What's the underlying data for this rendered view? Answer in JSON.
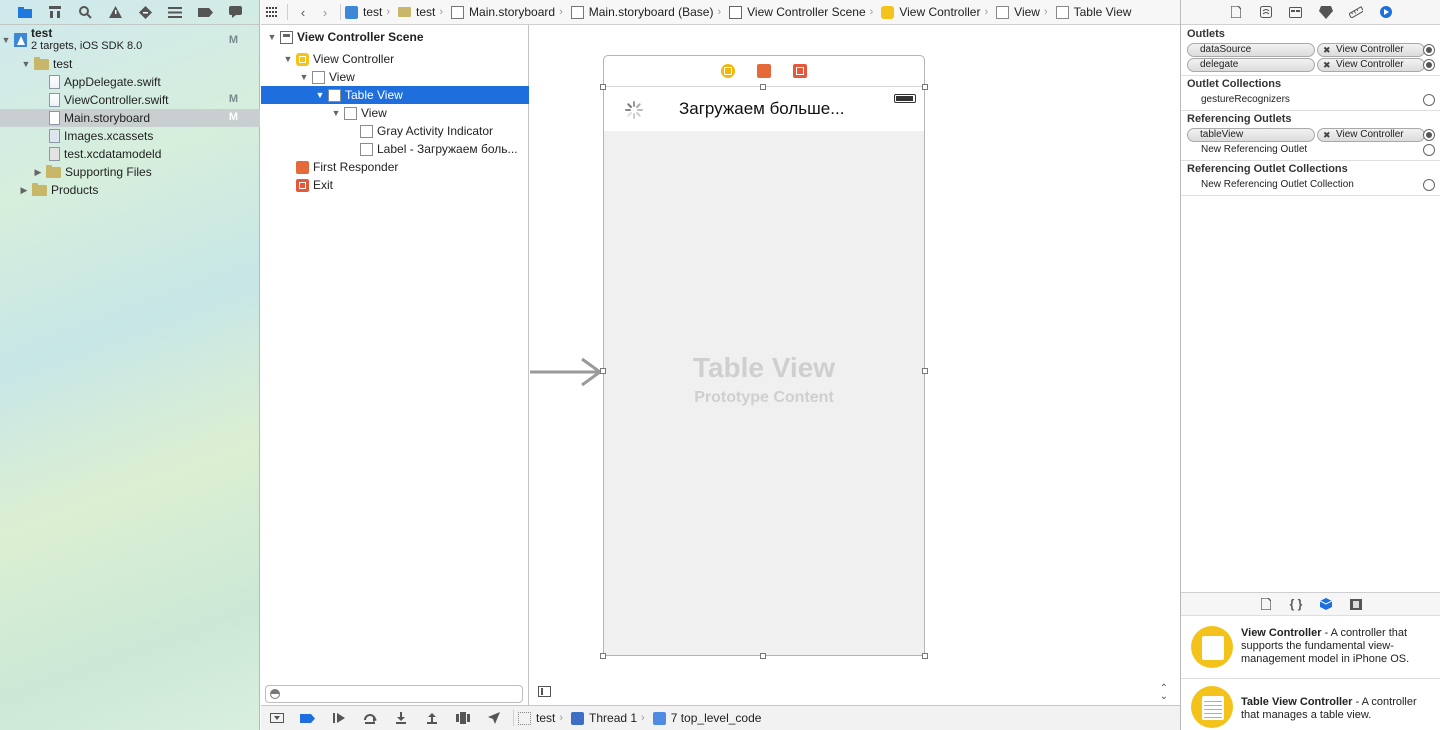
{
  "navigator": {
    "tabs": [
      "project-navigator",
      "symbol-navigator",
      "find-navigator",
      "issue-navigator",
      "test-navigator",
      "debug-navigator",
      "breakpoint-navigator",
      "report-navigator"
    ],
    "project": {
      "name": "test",
      "subtitle": "2 targets, iOS SDK 8.0",
      "badge": "M"
    },
    "items": [
      {
        "label": "test",
        "kind": "folder"
      },
      {
        "label": "AppDelegate.swift",
        "kind": "swift",
        "badge": ""
      },
      {
        "label": "ViewController.swift",
        "kind": "swift",
        "badge": "M"
      },
      {
        "label": "Main.storyboard",
        "kind": "storyboard",
        "badge": "M"
      },
      {
        "label": "Images.xcassets",
        "kind": "assets",
        "badge": ""
      },
      {
        "label": "test.xcdatamodeld",
        "kind": "datamodel",
        "badge": ""
      },
      {
        "label": "Supporting Files",
        "kind": "folder"
      },
      {
        "label": "Products",
        "kind": "folder"
      }
    ]
  },
  "jumpbar": {
    "crumbs": [
      "test",
      "test",
      "Main.storyboard",
      "Main.storyboard (Base)",
      "View Controller Scene",
      "View Controller",
      "View",
      "Table View"
    ]
  },
  "outline": {
    "items": [
      {
        "label": "View Controller Scene"
      },
      {
        "label": "View Controller"
      },
      {
        "label": "View"
      },
      {
        "label": "Table View"
      },
      {
        "label": "View"
      },
      {
        "label": "Gray Activity Indicator"
      },
      {
        "label": "Label - Загружаем боль..."
      },
      {
        "label": "First Responder"
      },
      {
        "label": "Exit"
      }
    ]
  },
  "canvas": {
    "loading_label": "Загружаем больше...",
    "placeholder_title": "Table View",
    "placeholder_subtitle": "Prototype Content"
  },
  "debugbar": {
    "crumbs": [
      "test",
      "Thread 1",
      "7 top_level_code"
    ]
  },
  "inspector": {
    "sections": {
      "outlets": "Outlets",
      "outlet_collections": "Outlet Collections",
      "referencing_outlets": "Referencing Outlets",
      "referencing_outlet_collections": "Referencing Outlet Collections"
    },
    "outlets": [
      {
        "name": "dataSource",
        "target": "View Controller"
      },
      {
        "name": "delegate",
        "target": "View Controller"
      }
    ],
    "outlet_collection": "gestureRecognizers",
    "referencing_outlet": {
      "name": "tableView",
      "target": "View Controller"
    },
    "new_referencing_outlet": "New Referencing Outlet",
    "new_referencing_outlet_collection": "New Referencing Outlet Collection"
  },
  "library": {
    "items": [
      {
        "name": "View Controller",
        "description": " - A controller that supports the fundamental view-management model in iPhone OS."
      },
      {
        "name": "Table View Controller",
        "description": " - A controller that manages a table view."
      }
    ]
  },
  "colors": {
    "selection": "#1f6ede",
    "accent": "#1f7ae0",
    "vc_yellow": "#f3c21b",
    "exit_orange": "#e5593a"
  }
}
